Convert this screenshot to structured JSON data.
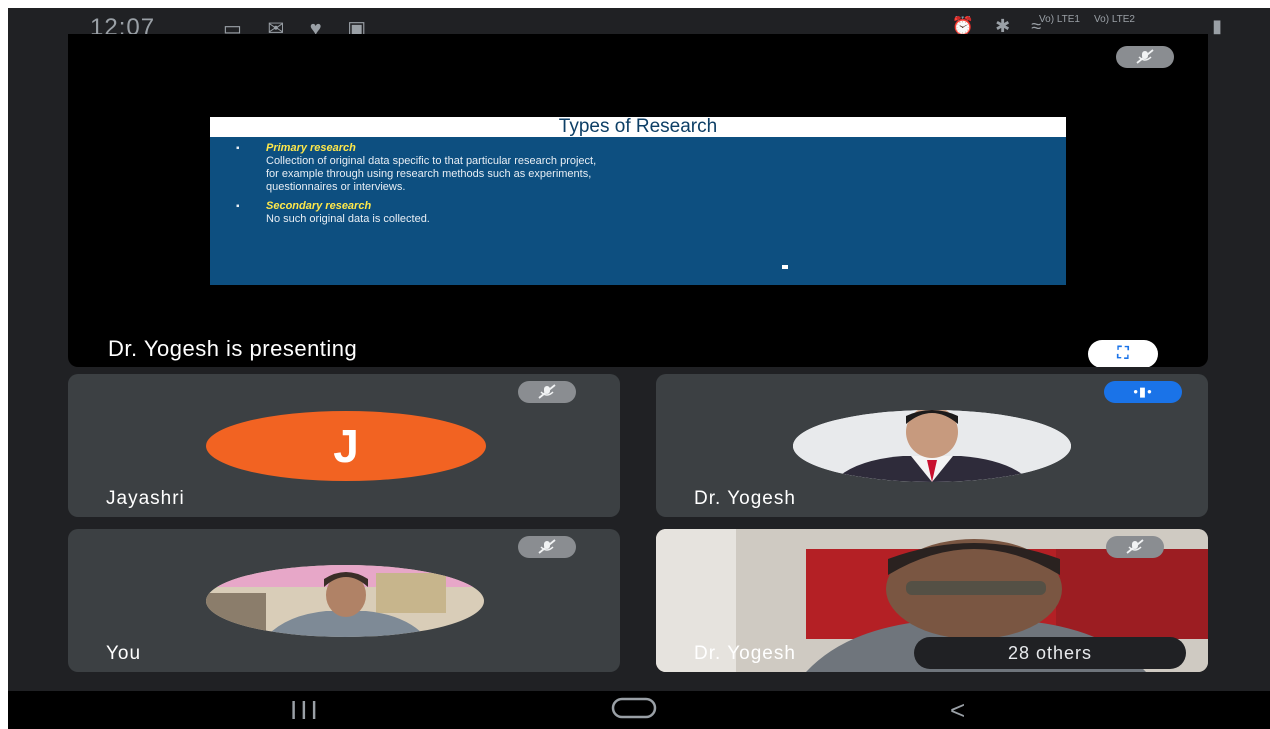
{
  "status_bar": {
    "time": "12:07",
    "left_icons": "▭ ✉ ♥ ▣",
    "lte1": "Vo) LTE1",
    "lte2": "Vo) LTE2",
    "right_icons": "⏰ ✱ ≈ ▮"
  },
  "presentation": {
    "slide": {
      "title": "Types of Research",
      "bullet1_heading": "Primary research",
      "bullet1_line1": "Collection of original data specific to that particular research project,",
      "bullet1_line2": "for example through using research methods such as experiments,",
      "bullet1_line3": "questionnaires or interviews.",
      "bullet2_heading": "Secondary research",
      "bullet2_line1": "No such original data is collected."
    },
    "label": "Dr. Yogesh is presenting",
    "fullscreen_glyph": "⛶",
    "mute_glyph": "🎙̸"
  },
  "tiles": [
    {
      "name": "Jayashri",
      "initial": "J",
      "muted": true,
      "avatar_color": "#f26322"
    },
    {
      "name": "Dr. Yogesh",
      "speaking": true,
      "speaking_glyph": "•▮•"
    },
    {
      "name": "You",
      "muted": true
    },
    {
      "name": "Dr. Yogesh",
      "muted": true,
      "others_label": "28 others"
    }
  ],
  "nav": {
    "recents": "III",
    "home": "◯",
    "back": "<"
  },
  "colors": {
    "bg": "#202124",
    "tile": "#3c4043",
    "accent": "#1a73e8",
    "slide_bg": "#0d4f80",
    "slide_heading": "#ffe84a"
  }
}
